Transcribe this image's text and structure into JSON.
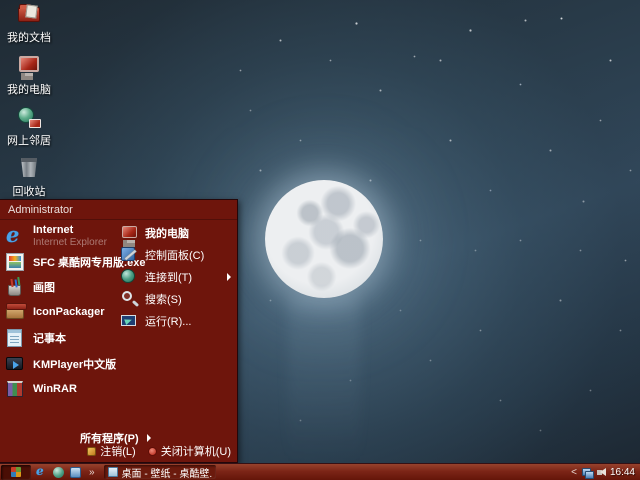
{
  "desktop": {
    "icons": [
      {
        "label": "我的文档",
        "icon": "my-documents-icon"
      },
      {
        "label": "我的电脑",
        "icon": "my-computer-icon"
      },
      {
        "label": "网上邻居",
        "icon": "network-places-icon"
      },
      {
        "label": "回收站",
        "icon": "recycle-bin-icon"
      }
    ]
  },
  "start_menu": {
    "user": "Administrator",
    "left_items": [
      {
        "label": "Internet",
        "sub": "Internet Explorer",
        "icon": "internet-explorer-icon"
      },
      {
        "label": "SFC 桌酷网专用版.exe",
        "icon": "sfc-app-icon"
      },
      {
        "label": "画图",
        "icon": "paint-icon"
      },
      {
        "label": "IconPackager",
        "icon": "iconpackager-icon"
      },
      {
        "label": "记事本",
        "icon": "notepad-icon"
      },
      {
        "label": "KMPlayer中文版",
        "icon": "kmplayer-icon"
      },
      {
        "label": "WinRAR",
        "icon": "winrar-icon"
      }
    ],
    "right_items": [
      {
        "label": "我的电脑",
        "icon": "my-computer-icon"
      },
      {
        "label": "控制面板(C)",
        "icon": "control-panel-icon"
      },
      {
        "label": "连接到(T)",
        "icon": "connect-to-icon"
      },
      {
        "label": "搜索(S)",
        "icon": "search-icon"
      },
      {
        "label": "运行(R)...",
        "icon": "run-icon"
      }
    ],
    "all_programs": "所有程序(P)",
    "log_off": "注销(L)",
    "shut_down": "关闭计算机(U)"
  },
  "taskbar": {
    "quick_launch_overflow": "»",
    "task_button": "桌面 - 壁纸 - 桌酷壁...",
    "tray_collapse": "<",
    "clock": "16:44"
  },
  "colors": {
    "menu_red": "#6e150c",
    "taskbar_red": "#7c2517",
    "sky_dark": "#1f2a33",
    "sky_light": "#31475a",
    "moon": "#edeff1"
  }
}
